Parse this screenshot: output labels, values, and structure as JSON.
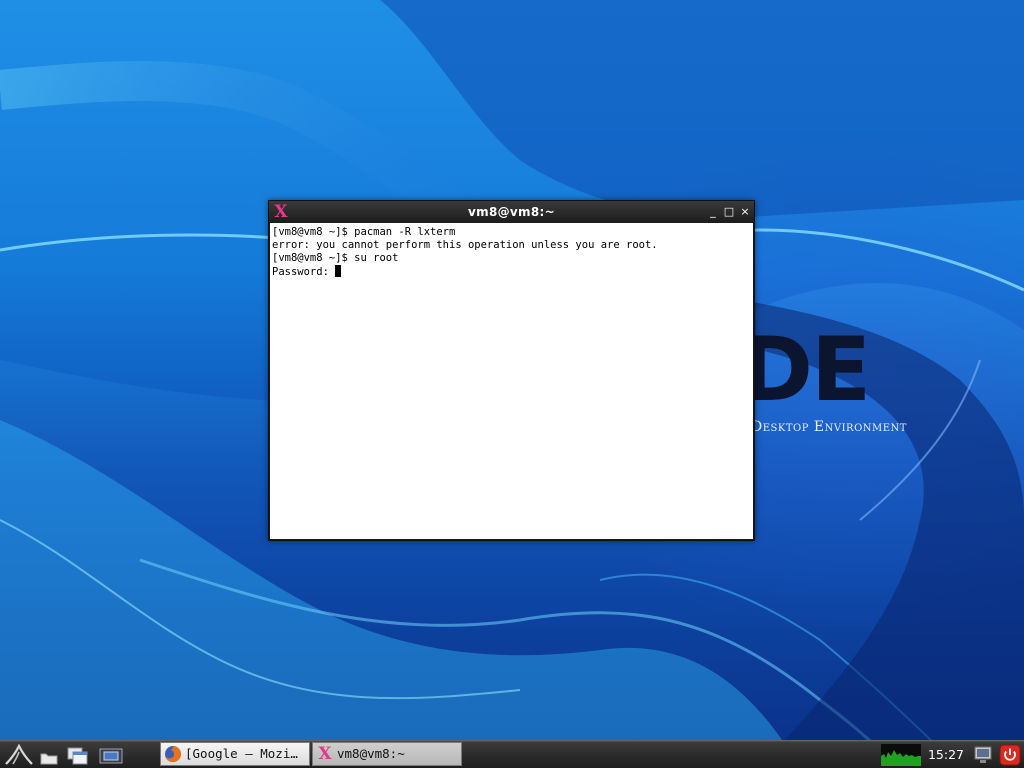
{
  "desktop": {
    "logo_text": "DE",
    "logo_subtitle": "Desktop Environment"
  },
  "terminal": {
    "title": "vm8@vm8:~",
    "controls": {
      "minimize": "_",
      "maximize": "□",
      "close": "×"
    },
    "lines": [
      "[vm8@vm8 ~]$ pacman -R lxterm",
      "error: you cannot perform this operation unless you are root.",
      "[vm8@vm8 ~]$ su root",
      "Password: "
    ]
  },
  "taskbar": {
    "tasks": [
      {
        "label": "[Google — Mozi…",
        "icon": "firefox-icon"
      },
      {
        "label": "vm8@vm8:~",
        "icon": "xterm-icon"
      }
    ],
    "clock": "15:27"
  },
  "colors": {
    "wallpaper_top": "#1f8fe6",
    "wallpaper_bottom": "#0a2f86",
    "titlebar": "#1c1c1c",
    "terminal_bg": "#ffffff",
    "xterm_icon": "#e33a8c",
    "cpu_graph": "#1fa21f",
    "power_button": "#d82a1e"
  }
}
